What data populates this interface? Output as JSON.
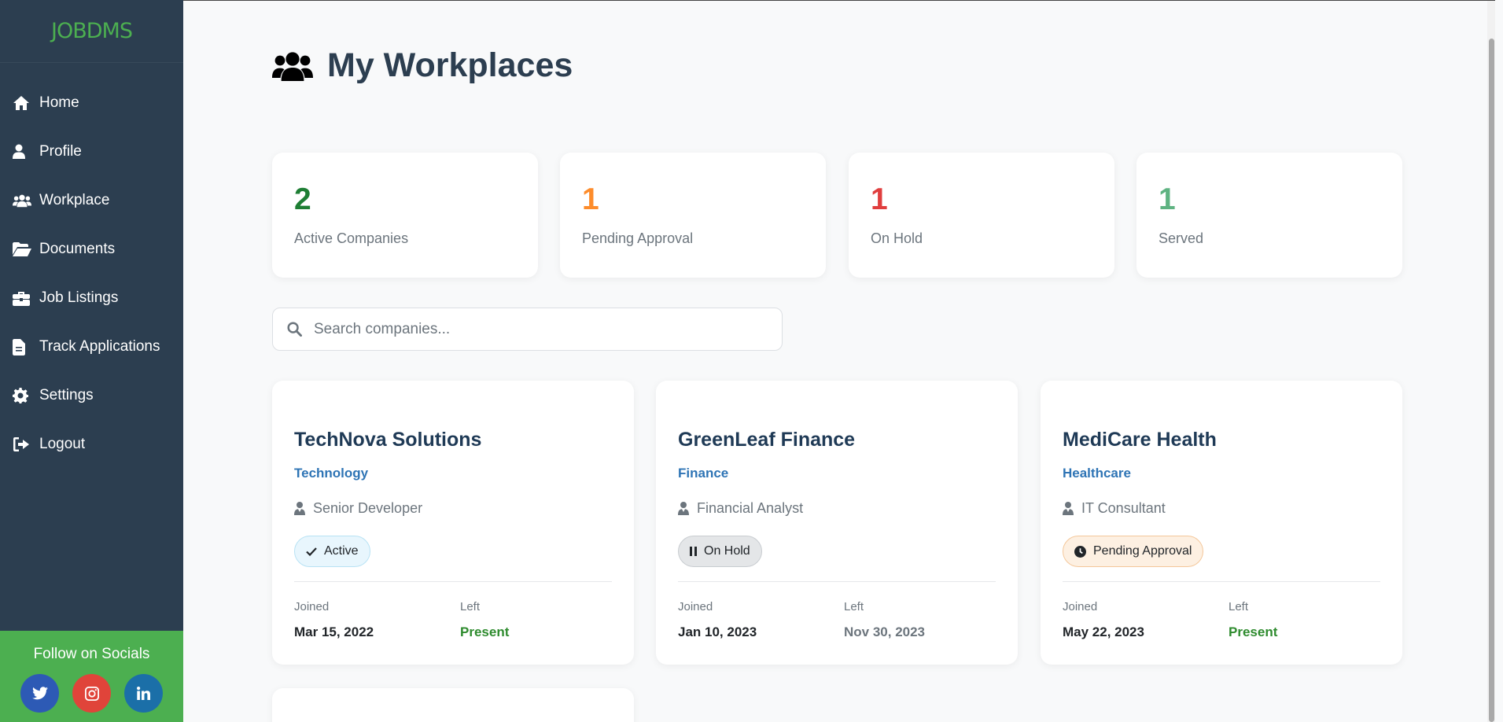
{
  "app": {
    "logo": "JOBDMS"
  },
  "sidebar": {
    "items": [
      {
        "label": "Home",
        "icon": "home-icon"
      },
      {
        "label": "Profile",
        "icon": "user-icon"
      },
      {
        "label": "Workplace",
        "icon": "users-icon"
      },
      {
        "label": "Documents",
        "icon": "folder-open-icon"
      },
      {
        "label": "Job Listings",
        "icon": "briefcase-icon"
      },
      {
        "label": "Track Applications",
        "icon": "file-icon"
      },
      {
        "label": "Settings",
        "icon": "gear-icon"
      },
      {
        "label": "Logout",
        "icon": "logout-icon"
      }
    ],
    "social": {
      "title": "Follow on Socials",
      "links": [
        {
          "icon": "twitter-icon",
          "color": "#2d5ab5"
        },
        {
          "icon": "instagram-icon",
          "color": "#e0443a"
        },
        {
          "icon": "linkedin-icon",
          "color": "#1b6fa8"
        }
      ]
    }
  },
  "page": {
    "title": "My Workplaces",
    "title_icon": "users-icon"
  },
  "stats": [
    {
      "value": "2",
      "label": "Active Companies",
      "color": "#1e7e34"
    },
    {
      "value": "1",
      "label": "Pending Approval",
      "color": "#fd8c2b"
    },
    {
      "value": "1",
      "label": "On Hold",
      "color": "#e03e3e"
    },
    {
      "value": "1",
      "label": "Served",
      "color": "#5fb382"
    }
  ],
  "search": {
    "placeholder": "Search companies...",
    "value": ""
  },
  "companies": [
    {
      "name": "TechNova Solutions",
      "industry": "Technology",
      "role": "Senior Developer",
      "status": "Active",
      "status_icon": "check-icon",
      "joined_label": "Joined",
      "joined": "Mar 15, 2022",
      "left_label": "Left",
      "left": "Present"
    },
    {
      "name": "GreenLeaf Finance",
      "industry": "Finance",
      "role": "Financial Analyst",
      "status": "On Hold",
      "status_icon": "pause-icon",
      "joined_label": "Joined",
      "joined": "Jan 10, 2023",
      "left_label": "Left",
      "left": "Nov 30, 2023"
    },
    {
      "name": "MediCare Health",
      "industry": "Healthcare",
      "role": "IT Consultant",
      "status": "Pending Approval",
      "status_icon": "clock-icon",
      "joined_label": "Joined",
      "joined": "May 22, 2023",
      "left_label": "Left",
      "left": "Present"
    }
  ]
}
